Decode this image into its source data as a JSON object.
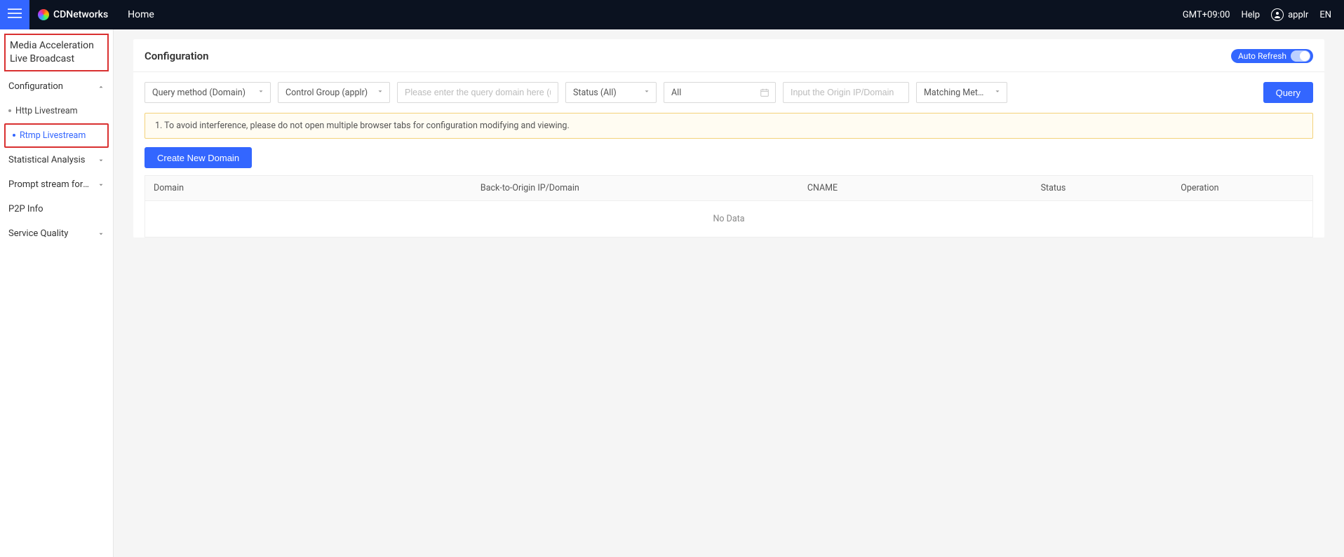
{
  "topbar": {
    "brand": "CDNetworks",
    "home": "Home",
    "timezone": "GMT+09:00",
    "help": "Help",
    "username": "applr",
    "language": "EN"
  },
  "sidebar": {
    "section_title_l1": "Media Acceleration",
    "section_title_l2": "Live Broadcast",
    "items": [
      {
        "label": "Configuration",
        "expandable": true,
        "expanded": true
      },
      {
        "label": "Http Livestream",
        "sub": true
      },
      {
        "label": "Rtmp Livestream",
        "sub": true,
        "active": true
      },
      {
        "label": "Statistical Analysis",
        "expandable": true
      },
      {
        "label": "Prompt stream forbidd...",
        "expandable": true
      },
      {
        "label": "P2P Info"
      },
      {
        "label": "Service Quality",
        "expandable": true
      }
    ]
  },
  "page": {
    "title": "Configuration",
    "auto_refresh_label": "Auto Refresh"
  },
  "filters": {
    "query_method": "Query method (Domain)",
    "control_group": "Control Group (applr)",
    "domain_placeholder": "Please enter the query domain here (use ; to s",
    "status": "Status (All)",
    "date": "All",
    "origin_placeholder": "Input the Origin IP/Domain",
    "matching_method": "Matching Method (Fu...",
    "query_button": "Query"
  },
  "notice": "1. To avoid interference, please do not open multiple browser tabs for configuration modifying and viewing.",
  "actions": {
    "create_domain": "Create New Domain"
  },
  "table": {
    "columns": {
      "domain": "Domain",
      "origin": "Back-to-Origin IP/Domain",
      "cname": "CNAME",
      "status": "Status",
      "operation": "Operation"
    },
    "no_data": "No Data"
  }
}
